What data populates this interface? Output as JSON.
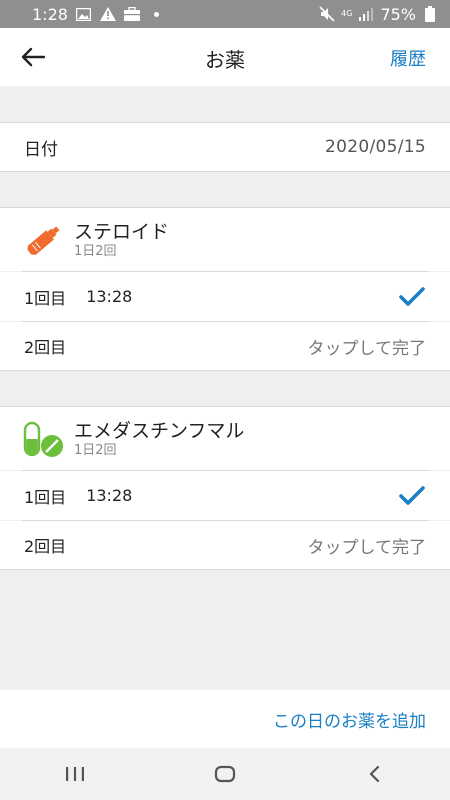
{
  "status_bar": {
    "time": "1:28",
    "network": "4G",
    "battery": "75%",
    "icons": [
      "image-icon",
      "warning-icon",
      "briefcase-icon",
      "dot-icon",
      "mute-icon",
      "signal-icon",
      "battery-icon"
    ]
  },
  "header": {
    "title": "お薬",
    "history_label": "履歴",
    "back_icon": "back-arrow-icon"
  },
  "date": {
    "label": "日付",
    "value": "2020/05/15"
  },
  "medicines": [
    {
      "name": "ステロイド",
      "frequency": "1日2回",
      "icon": "ointment-tube-icon",
      "icon_color": "#f26a2e",
      "doses": [
        {
          "label": "1回目",
          "time": "13:28",
          "done": true
        },
        {
          "label": "2回目",
          "time": "",
          "status_text": "タップして完了"
        }
      ]
    },
    {
      "name": "エメダスチンフマル",
      "frequency": "1日2回",
      "icon": "pill-capsule-icon",
      "icon_color": "#6cbf3a",
      "doses": [
        {
          "label": "1回目",
          "time": "13:28",
          "done": true
        },
        {
          "label": "2回目",
          "time": "",
          "status_text": "タップして完了"
        }
      ]
    }
  ],
  "footer": {
    "add_label": "この日のお薬を追加"
  },
  "colors": {
    "accent": "#1a7fc4",
    "check": "#1a7fc4",
    "background": "#eeeff1"
  },
  "nav_bar": {
    "icons": [
      "recents-icon",
      "home-icon",
      "back-icon"
    ]
  }
}
